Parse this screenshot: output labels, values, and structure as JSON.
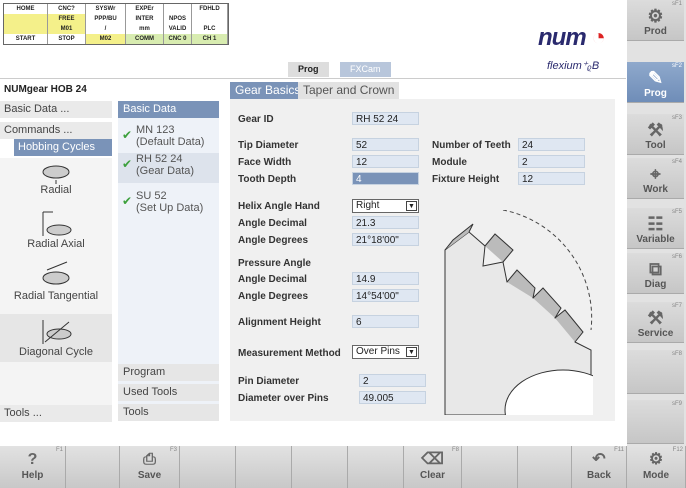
{
  "status": {
    "row1": [
      "HOME",
      "CNC?",
      "SYSWr",
      "EXPEr",
      "",
      "FDHLD"
    ],
    "row2": [
      "",
      "FREE",
      "PPP/BU",
      "INTER",
      "NPOS",
      ""
    ],
    "row3": [
      "",
      "M01",
      "/",
      "mm",
      "VALID",
      "PLC"
    ],
    "row4": [
      "START",
      "STOP",
      "M02",
      "COMM",
      "CNC 0",
      "CH 1"
    ]
  },
  "brand": {
    "logo_text": "num",
    "logo_mark": "◔",
    "sub": "flexium⁺ᵨB"
  },
  "breadcrumb": {
    "item1": "Prog",
    "item2": "FXCam"
  },
  "title": "NUMgear HOB 24",
  "left": {
    "basic_data": "Basic Data ...",
    "commands": "Commands ...",
    "hobbing": "Hobbing Cycles",
    "tools": "Tools ...",
    "cycles": [
      "Radial",
      "Radial Axial",
      "Radial Tangential",
      "Diagonal Cycle"
    ]
  },
  "mid": {
    "header": "Basic Data",
    "items": [
      {
        "l1": "MN 123",
        "l2": "(Default Data)"
      },
      {
        "l1": "RH 52 24",
        "l2": "(Gear Data)"
      },
      {
        "l1": "SU 52",
        "l2": "(Set Up Data)"
      }
    ],
    "program": "Program",
    "used_tools": "Used Tools",
    "tools": "Tools",
    "check": "✔"
  },
  "tabs": {
    "gear_basics": "Gear Basics",
    "taper": "Taper and Crown"
  },
  "form": {
    "gear_id_label": "Gear ID",
    "gear_id": "RH 52 24",
    "tip_label": "Tip Diameter",
    "tip": "52",
    "face_label": "Face Width",
    "face": "12",
    "depth_label": "Tooth Depth",
    "depth": "4",
    "teeth_label": "Number of Teeth",
    "teeth": "24",
    "module_label": "Module",
    "module": "2",
    "fixture_label": "Fixture Height",
    "fixture": "12",
    "helix_label": "Helix Angle Hand",
    "helix": "Right",
    "ang_dec_label": "Angle Decimal",
    "ang_dec": "21.3",
    "ang_deg_label": "Angle Degrees",
    "ang_deg": "21°18'00\"",
    "press_label": "Pressure Angle",
    "p_dec_label": "Angle Decimal",
    "p_dec": "14.9",
    "p_deg_label": "Angle Degrees",
    "p_deg": "14°54'00\"",
    "align_label": "Alignment Height",
    "align": "6",
    "meas_label": "Measurement Method",
    "meas": "Over Pins",
    "pin_label": "Pin Diameter",
    "pin": "2",
    "dop_label": "Diameter over Pins",
    "dop": "49.005"
  },
  "right": [
    {
      "label": "Prod",
      "key": "sF1",
      "icon": "⚙"
    },
    {
      "label": "Prog",
      "key": "sF2",
      "icon": "✎"
    },
    {
      "label": "Tool",
      "key": "sF3",
      "icon": "⚒"
    },
    {
      "label": "Work",
      "key": "sF4",
      "icon": "⌖"
    },
    {
      "label": "Variable",
      "key": "sF5",
      "icon": "☷"
    },
    {
      "label": "Diag",
      "key": "sF6",
      "icon": "⧉"
    },
    {
      "label": "Service",
      "key": "sF7",
      "icon": "⚒"
    },
    {
      "label": "",
      "key": "sF8",
      "icon": ""
    },
    {
      "label": "",
      "key": "sF9",
      "icon": ""
    }
  ],
  "bottom": {
    "help": "Help",
    "help_key": "F1",
    "help_icon": "?",
    "save": "Save",
    "save_key": "F3",
    "save_icon": "⎙",
    "clear": "Clear",
    "clear_key": "F8",
    "clear_icon": "⌫",
    "back": "Back",
    "back_key": "F11",
    "back_icon": "↶",
    "mode": "Mode",
    "mode_key": "F12",
    "mode_icon": "⚙"
  }
}
